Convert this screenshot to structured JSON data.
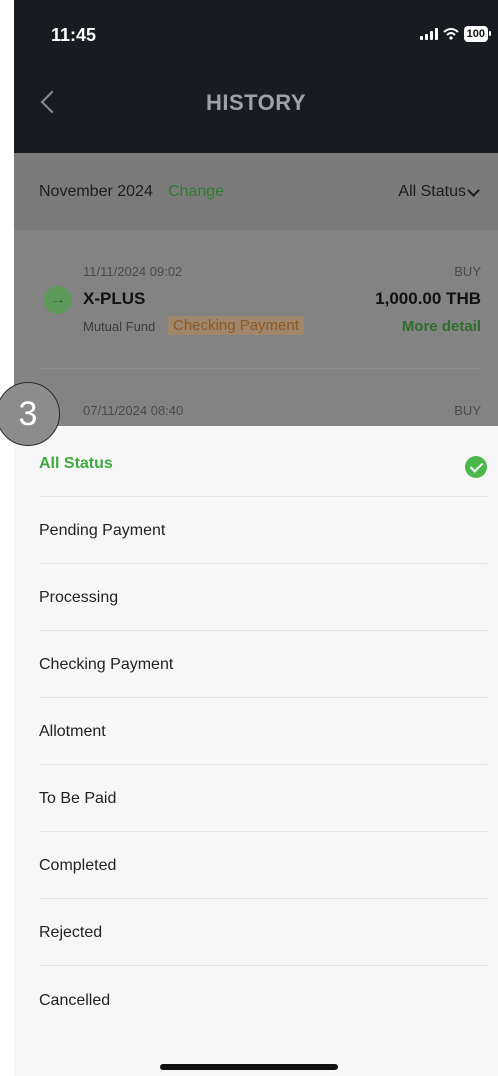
{
  "status_bar": {
    "time": "11:45",
    "battery": "100"
  },
  "header": {
    "title": "HISTORY"
  },
  "filter": {
    "month": "November 2024",
    "change_label": "Change",
    "status_label": "All Status"
  },
  "transactions": [
    {
      "datetime": "11/11/2024 09:02",
      "type": "BUY",
      "name": "X-PLUS",
      "amount": "1,000.00 THB",
      "category": "Mutual Fund",
      "status": "Checking Payment",
      "more": "More detail"
    },
    {
      "datetime": "07/11/2024 08:40",
      "type": "BUY"
    }
  ],
  "step_badge": "3",
  "status_options": [
    "All Status",
    "Pending Payment",
    "Processing",
    "Checking Payment",
    "Allotment",
    "To Be Paid",
    "Completed",
    "Rejected",
    "Cancelled"
  ],
  "selected_option": "All Status",
  "colors": {
    "accent_green": "#3ea93e",
    "header_bg": "#181b20"
  }
}
